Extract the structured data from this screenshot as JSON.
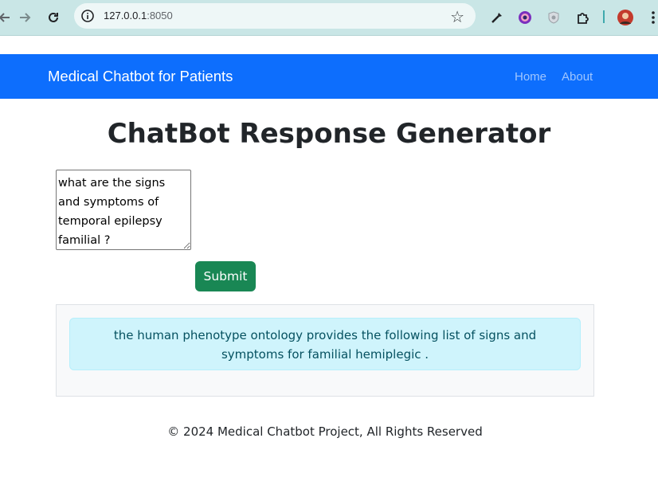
{
  "browser": {
    "url_host": "127.0.0.1",
    "url_port": ":8050"
  },
  "navbar": {
    "brand": "Medical Chatbot for Patients",
    "links": [
      "Home",
      "About"
    ],
    "color": "#0d6efd"
  },
  "main": {
    "title": "ChatBot Response Generator",
    "question_value": "what are the signs and symptoms of temporal epilepsy familial ?",
    "submit_label": "Submit",
    "response": "the human phenotype ontology provides the following list of signs and symptoms for familial hemiplegic ."
  },
  "footer": {
    "text": "© 2024 Medical Chatbot Project, All Rights Reserved"
  },
  "colors": {
    "submit": "#198754",
    "alert_bg": "#cff4fc",
    "alert_text": "#055160"
  }
}
